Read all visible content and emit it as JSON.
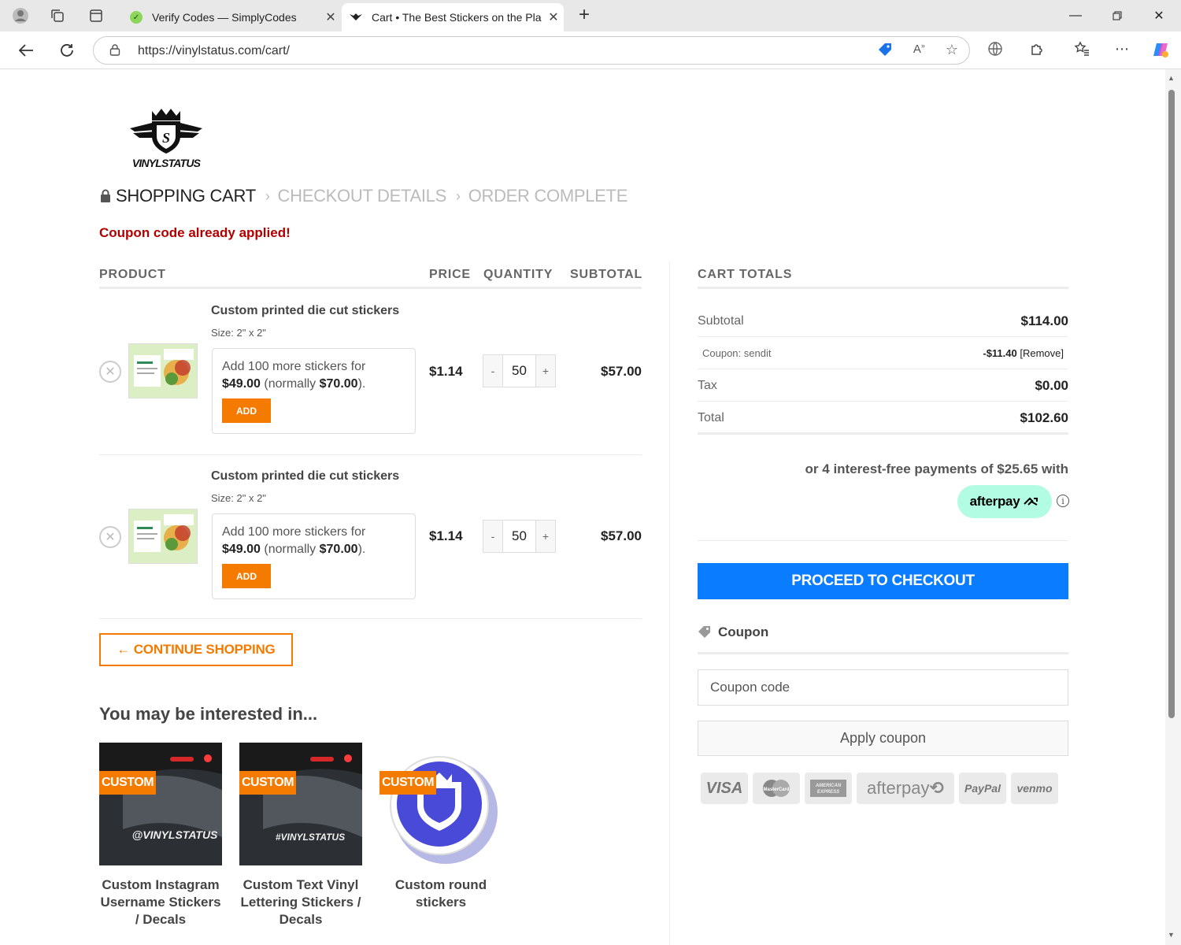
{
  "browser": {
    "tabs": [
      {
        "title": "Verify Codes — SimplyCodes",
        "active": false
      },
      {
        "title": "Cart • The Best Stickers on the Pla",
        "active": true
      }
    ],
    "url": "https://vinylstatus.com/cart/"
  },
  "brand": {
    "logo_text": "VINYLSTATUS"
  },
  "steps": {
    "current": "SHOPPING CART",
    "next": "CHECKOUT DETAILS",
    "last": "ORDER COMPLETE"
  },
  "notice": "Coupon code already applied!",
  "cart": {
    "headers": {
      "product": "PRODUCT",
      "price": "PRICE",
      "quantity": "QUANTITY",
      "subtotal": "SUBTOTAL"
    },
    "items": [
      {
        "name": "Custom printed die cut stickers",
        "size": "Size:  2\" x 2\"",
        "upsell_line1": "Add 100 more stickers for",
        "upsell_price": "$49.00",
        "upsell_normal": "(normally ",
        "upsell_normal_price": "$70.00",
        "upsell_end": ").",
        "add_label": "ADD",
        "price": "$1.14",
        "quantity": "50",
        "subtotal": "$57.00"
      },
      {
        "name": "Custom printed die cut stickers",
        "size": "Size:  2\" x 2\"",
        "upsell_line1": "Add 100 more stickers for",
        "upsell_price": "$49.00",
        "upsell_normal": "(normally ",
        "upsell_normal_price": "$70.00",
        "upsell_end": ").",
        "add_label": "ADD",
        "price": "$1.14",
        "quantity": "50",
        "subtotal": "$57.00"
      }
    ],
    "qty_minus": "-",
    "qty_plus": "+",
    "continue_label": "← CONTINUE SHOPPING"
  },
  "recommendations": {
    "title": "You may be interested in...",
    "badge": "CUSTOM",
    "items": [
      {
        "name": "Custom Instagram Username Stickers / Decals",
        "image_text": "@VINYLSTATUS"
      },
      {
        "name": "Custom Text Vinyl Lettering Stickers / Decals",
        "image_text": "#VINYLSTATUS"
      },
      {
        "name": "Custom round stickers",
        "image_text": ""
      }
    ]
  },
  "totals": {
    "title": "CART TOTALS",
    "subtotal_label": "Subtotal",
    "subtotal_value": "$114.00",
    "coupon_label": "Coupon: sendit",
    "coupon_value": "-$11.40",
    "coupon_remove": "[Remove]",
    "tax_label": "Tax",
    "tax_value": "$0.00",
    "total_label": "Total",
    "total_value": "$102.60",
    "afterpay_text": "or 4 interest-free payments of $25.65 with",
    "afterpay_badge": "afterpay",
    "checkout_label": "PROCEED TO CHECKOUT",
    "coupon_heading": "Coupon",
    "coupon_placeholder": "Coupon code",
    "apply_label": "Apply coupon",
    "payment_methods": [
      "VISA",
      "MasterCard",
      "AMERICAN EXPRESS",
      "afterpay",
      "PayPal",
      "venmo"
    ]
  }
}
